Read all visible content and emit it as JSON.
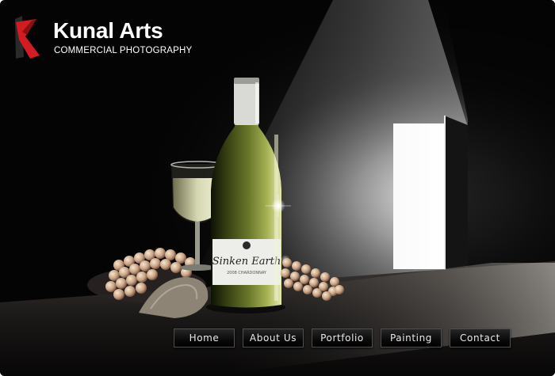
{
  "brand": {
    "title": "Kunal Arts",
    "subtitle": "COMMERCIAL PHOTOGRAPHY",
    "logo_icon": "red-k-logo-icon",
    "accent_color": "#d21c22"
  },
  "hero": {
    "subject": "wine-bottle-still-life",
    "bottle_label": "Sinken Earth",
    "bottle_label_sub": "2008 CHARDONNAY"
  },
  "nav": {
    "items": [
      {
        "label": "Home"
      },
      {
        "label": "About Us"
      },
      {
        "label": "Portfolio"
      },
      {
        "label": "Painting"
      },
      {
        "label": "Contact"
      }
    ]
  }
}
